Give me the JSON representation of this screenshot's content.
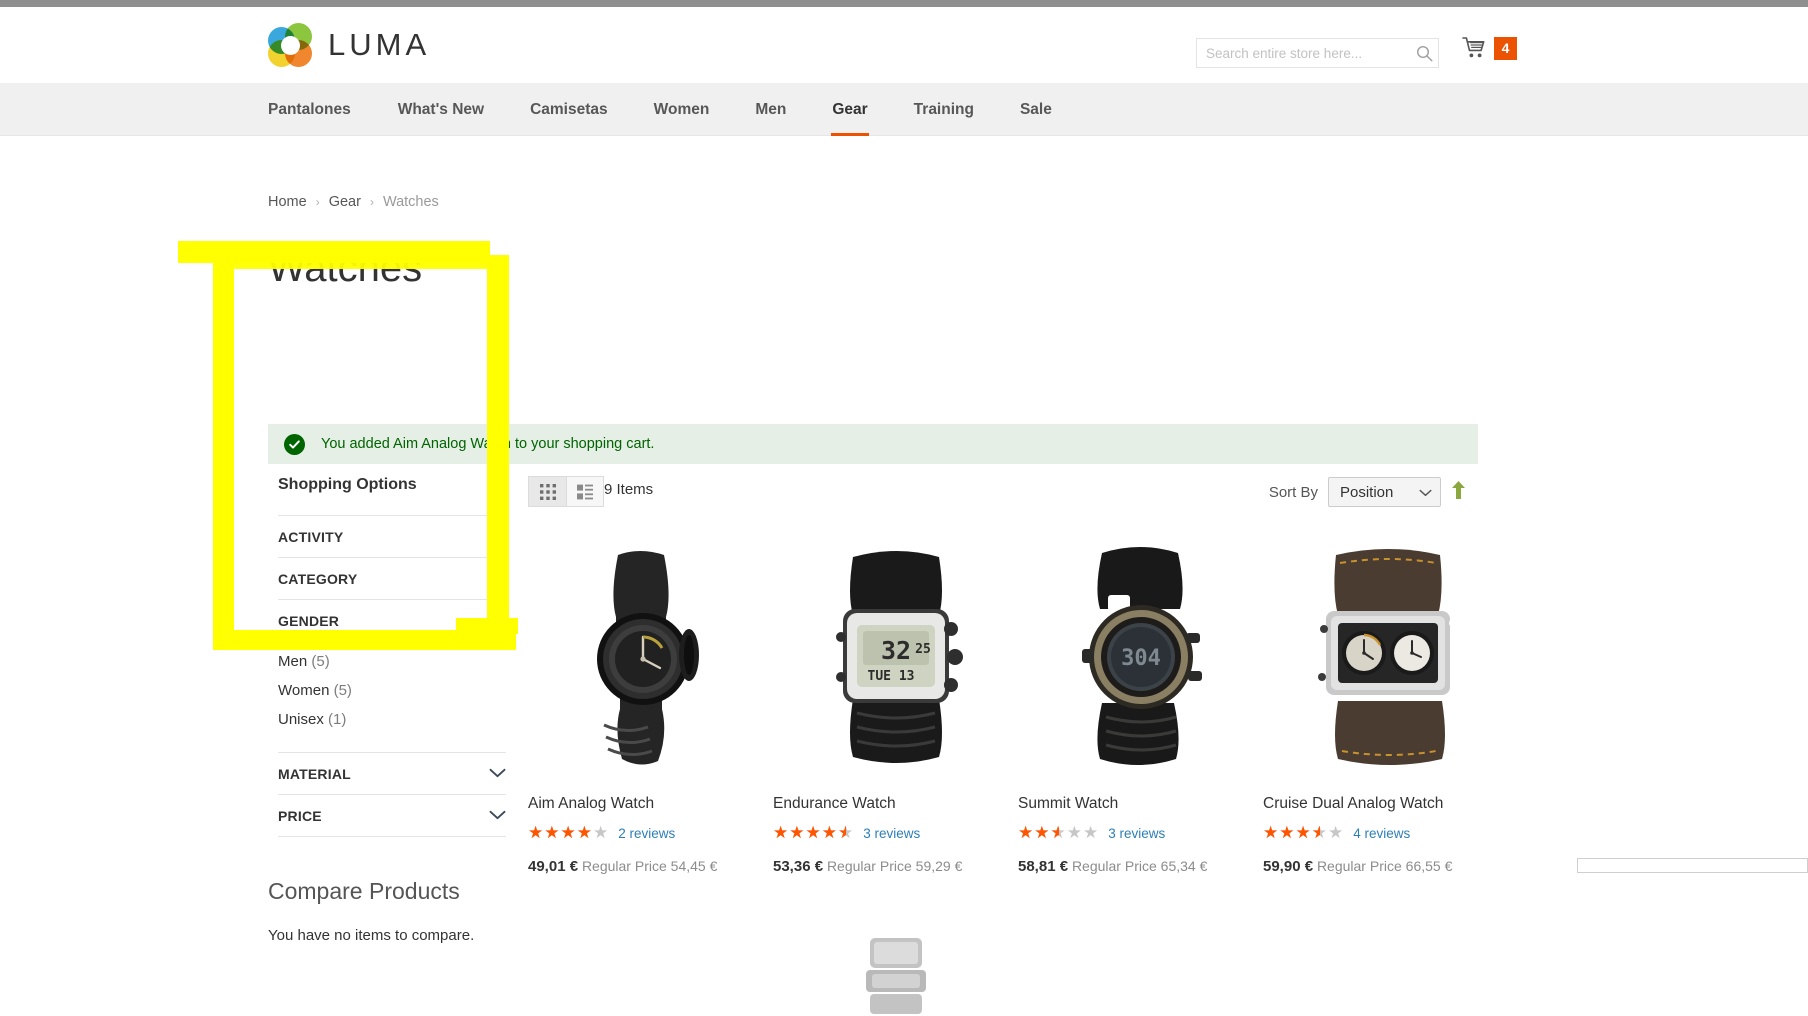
{
  "header": {
    "logo_text": "LUMA",
    "search": {
      "placeholder": "Search entire store here...",
      "value": "",
      "icon": "search-icon"
    },
    "cart": {
      "icon": "shopping-cart-icon",
      "count": "4"
    }
  },
  "nav": {
    "items": [
      {
        "label": "Pantalones",
        "active": false
      },
      {
        "label": "What's New",
        "active": false
      },
      {
        "label": "Camisetas",
        "active": false
      },
      {
        "label": "Women",
        "active": false
      },
      {
        "label": "Men",
        "active": false
      },
      {
        "label": "Gear",
        "active": true
      },
      {
        "label": "Training",
        "active": false
      },
      {
        "label": "Sale",
        "active": false
      }
    ]
  },
  "breadcrumb": {
    "home": "Home",
    "gear": "Gear",
    "current": "Watches",
    "separator": "›"
  },
  "page_title": "Watches",
  "message": {
    "icon": "check-circle-icon",
    "text": "You added Aim Analog Watch to your shopping cart."
  },
  "sidebar": {
    "heading": "Shopping Options",
    "filters": [
      {
        "title": "ACTIVITY",
        "expanded": false,
        "icon": "chevron-down-icon",
        "options": []
      },
      {
        "title": "CATEGORY",
        "expanded": false,
        "icon": "chevron-down-icon",
        "options": []
      },
      {
        "title": "GENDER",
        "expanded": true,
        "icon": "chevron-up-icon",
        "options": [
          {
            "label": "Men",
            "count": "(5)"
          },
          {
            "label": "Women",
            "count": "(5)"
          },
          {
            "label": "Unisex",
            "count": "(1)"
          }
        ]
      },
      {
        "title": "MATERIAL",
        "expanded": false,
        "icon": "chevron-down-icon",
        "options": []
      },
      {
        "title": "PRICE",
        "expanded": false,
        "icon": "chevron-down-icon",
        "options": []
      }
    ],
    "compare": {
      "title": "Compare Products",
      "empty_text": "You have no items to compare."
    }
  },
  "toolbar": {
    "view_grid_icon": "grid-view-icon",
    "view_list_icon": "list-view-icon",
    "active_view": "grid",
    "items_count": "9 Items",
    "sort_label": "Sort By",
    "sort_value": "Position",
    "sort_chevron_icon": "chevron-down-icon",
    "sort_direction_icon": "arrow-up-icon"
  },
  "products": [
    {
      "name": "Aim Analog Watch",
      "rating_percent": 80,
      "reviews": "2 reviews",
      "price_special": "49,01 €",
      "price_regular_label": "Regular Price",
      "price_regular": "54,45 €",
      "image": "aim-analog-watch-image"
    },
    {
      "name": "Endurance Watch",
      "rating_percent": 90,
      "reviews": "3 reviews",
      "price_special": "53,36 €",
      "price_regular_label": "Regular Price",
      "price_regular": "59,29 €",
      "image": "endurance-watch-image"
    },
    {
      "name": "Summit Watch",
      "rating_percent": 50,
      "reviews": "3 reviews",
      "price_special": "58,81 €",
      "price_regular_label": "Regular Price",
      "price_regular": "65,34 €",
      "image": "summit-watch-image"
    },
    {
      "name": "Cruise Dual Analog Watch",
      "rating_percent": 70,
      "reviews": "4 reviews",
      "price_special": "59,90 €",
      "price_regular_label": "Regular Price",
      "price_regular": "66,55 €",
      "image": "cruise-dual-analog-watch-image"
    }
  ],
  "colors": {
    "accent_orange": "#eb5202",
    "star_orange": "#ff5501",
    "link_blue": "#2c7fb7",
    "success_green": "#006400",
    "success_bg": "#e5efe5",
    "highlight_yellow": "#ffff00",
    "nav_bg": "#f0f0f0"
  }
}
